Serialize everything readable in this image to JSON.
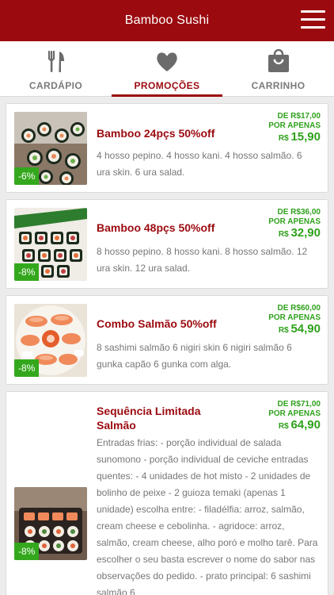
{
  "app": {
    "title": "Bamboo Sushi"
  },
  "tabs": [
    {
      "label": "CARDÁPIO",
      "icon": "fork-knife-icon",
      "active": false
    },
    {
      "label": "PROMOÇÕES",
      "icon": "heart-icon",
      "active": true
    },
    {
      "label": "CARRINHO",
      "icon": "shopping-bag-icon",
      "active": false
    }
  ],
  "promotions": [
    {
      "name": "Bamboo 24pçs 50%off",
      "discount": "-6%",
      "price_from": "DE R$17,00",
      "price_label": "POR APENAS",
      "currency": "R$",
      "price": "15,90",
      "description": "4 hosso pepino. 4 hosso kani. 4 hosso salmão. 6 ura skin. 6 ura salad."
    },
    {
      "name": "Bamboo 48pçs 50%off",
      "discount": "-8%",
      "price_from": "DE R$36,00",
      "price_label": "POR APENAS",
      "currency": "R$",
      "price": "32,90",
      "description": "8 hosso pepino. 8 hosso kani. 8 hosso salmão. 12 ura skin. 12 ura salad."
    },
    {
      "name": "Combo Salmão 50%off",
      "discount": "-8%",
      "price_from": "DE R$60,00",
      "price_label": "POR APENAS",
      "currency": "R$",
      "price": "54,90",
      "description": "8 sashimi salmão 6 nigiri skin 6 nigiri salmão 6 gunka capão 6 gunka com alga."
    },
    {
      "name": "Sequência Limitada Salmão",
      "discount": "-8%",
      "price_from": "DE R$71,00",
      "price_label": "POR APENAS",
      "currency": "R$",
      "price": "64,90",
      "description": "Entradas frias: - porção individual de salada sunomono - porção individual de ceviche entradas quentes: - 4 unidades de hot misto - 2 unidades de bolinho de peixe - 2 guioza temaki (apenas 1 unidade) escolha entre: - filadélfia: arroz, salmão, cream cheese e cebolinha. - agridoce: arroz, salmão, cream cheese, alho poró e molho tarê. Para escolher o seu basta escrever o nome do sabor nas observações do pedido. - prato principal: 6 sashimi salmão 6"
    }
  ],
  "colors": {
    "brand": "#9b0a0f",
    "price": "#2fa11c",
    "badge": "#34a81d"
  }
}
